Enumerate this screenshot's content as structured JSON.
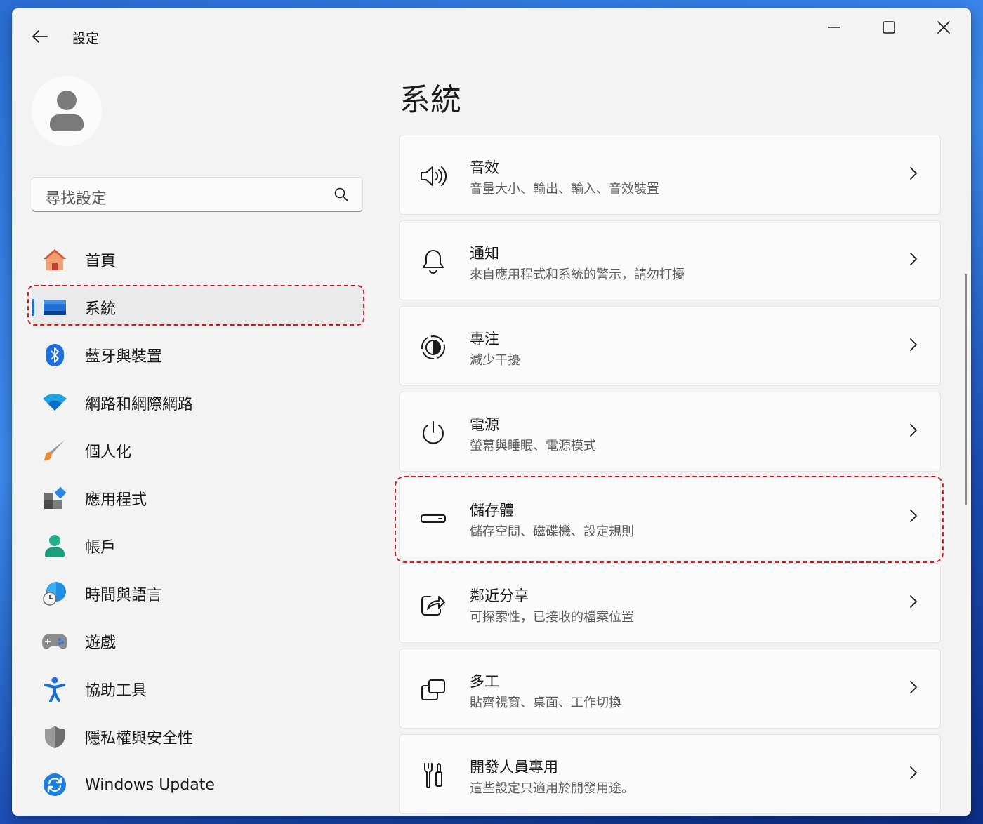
{
  "window": {
    "title": "設定"
  },
  "search": {
    "placeholder": "尋找設定"
  },
  "nav": {
    "items": [
      {
        "label": "首頁",
        "icon": "home-icon"
      },
      {
        "label": "系統",
        "icon": "system-icon",
        "selected": true
      },
      {
        "label": "藍牙與裝置",
        "icon": "bluetooth-icon"
      },
      {
        "label": "網路和網際網路",
        "icon": "wifi-icon"
      },
      {
        "label": "個人化",
        "icon": "brush-icon"
      },
      {
        "label": "應用程式",
        "icon": "apps-icon"
      },
      {
        "label": "帳戶",
        "icon": "account-icon"
      },
      {
        "label": "時間與語言",
        "icon": "time-language-icon"
      },
      {
        "label": "遊戲",
        "icon": "gamepad-icon"
      },
      {
        "label": "協助工具",
        "icon": "accessibility-icon"
      },
      {
        "label": "隱私權與安全性",
        "icon": "shield-icon"
      },
      {
        "label": "Windows Update",
        "icon": "update-icon"
      }
    ]
  },
  "main": {
    "title": "系統",
    "cards": [
      {
        "title": "音效",
        "subtitle": "音量大小、輸出、輸入、音效裝置",
        "icon": "speaker-icon"
      },
      {
        "title": "通知",
        "subtitle": "來自應用程式和系統的警示，請勿打擾",
        "icon": "bell-icon"
      },
      {
        "title": "專注",
        "subtitle": "減少干擾",
        "icon": "focus-icon"
      },
      {
        "title": "電源",
        "subtitle": "螢幕與睡眠、電源模式",
        "icon": "power-icon"
      },
      {
        "title": "儲存體",
        "subtitle": "儲存空間、磁碟機、設定規則",
        "icon": "storage-icon"
      },
      {
        "title": "鄰近分享",
        "subtitle": "可探索性，已接收的檔案位置",
        "icon": "share-icon"
      },
      {
        "title": "多工",
        "subtitle": "貼齊視窗、桌面、工作切換",
        "icon": "multitask-icon"
      },
      {
        "title": "開發人員專用",
        "subtitle": "這些設定只適用於開發用途。",
        "icon": "developer-icon"
      }
    ]
  },
  "colors": {
    "accent": "#1a6ed8",
    "highlight": "#d11c1c",
    "window_bg": "#f3f3f3",
    "card_bg": "#fbfbfb"
  }
}
